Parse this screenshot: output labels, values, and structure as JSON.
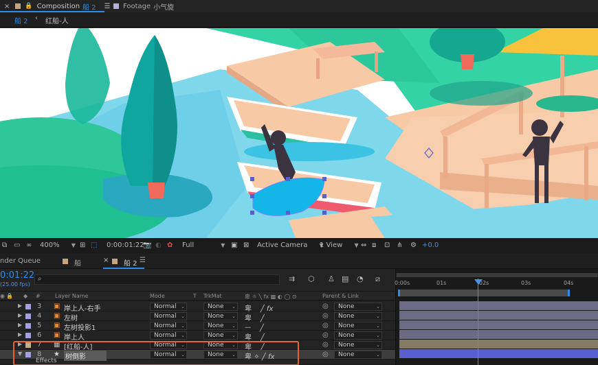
{
  "tabs": {
    "composition_label": "Composition",
    "composition_name": "船 2",
    "footage_label": "Footage",
    "footage_name": "小气旋"
  },
  "breadcrumb": {
    "current": "船 2",
    "parent": "红船-人"
  },
  "viewer_toolbar": {
    "zoom": "400%",
    "timecode": "0:00:01:22",
    "resolution": "Full",
    "camera": "Active Camera",
    "view": "1 View",
    "exposure": "+0.0"
  },
  "timeline_tabs": {
    "render_queue": "nder Queue",
    "comp1": "船",
    "comp2": "船 2"
  },
  "timeline": {
    "current_time": "0:01:22",
    "fps": "(25.00 fps)",
    "search_placeholder": "",
    "columns": {
      "num": "#",
      "layer_name": "Layer Name",
      "mode": "Mode",
      "t": "T",
      "trkmat": "TrkMat",
      "parent": "Parent & Link"
    },
    "ruler": [
      "0:00s",
      "01s",
      "02s",
      "03s",
      "04s"
    ],
    "layers": [
      {
        "num": "3",
        "name": "岸上人-右手",
        "mode": "Normal",
        "trkmat": "None",
        "parent": "None",
        "color": "#a4a0e0",
        "selected": false,
        "fx": true
      },
      {
        "num": "4",
        "name": "左树",
        "mode": "Normal",
        "trkmat": "None",
        "parent": "None",
        "color": "#a4a0e0",
        "selected": false,
        "fx": false
      },
      {
        "num": "5",
        "name": "左树投影1",
        "mode": "Normal",
        "trkmat": "None",
        "parent": "None",
        "color": "#a4a0e0",
        "selected": false,
        "fx": false
      },
      {
        "num": "6",
        "name": "岸上人",
        "mode": "Normal",
        "trkmat": "None",
        "parent": "None",
        "color": "#a4a0e0",
        "selected": false,
        "fx": false
      },
      {
        "num": "7",
        "name": "[红船-人]",
        "mode": "Normal",
        "trkmat": "None",
        "parent": "None",
        "color": "#bfae8c",
        "selected": false,
        "fx": false
      },
      {
        "num": "8",
        "name": "树倒影",
        "mode": "Normal",
        "trkmat": "None",
        "parent": "None",
        "color": "#a4a0e0",
        "selected": true,
        "fx": true
      }
    ],
    "effects_label": "Effects"
  },
  "colors": {
    "accent": "#2d8ceb",
    "highlight_box": "#e8642c",
    "selection_blue": "#5a5fd0"
  }
}
